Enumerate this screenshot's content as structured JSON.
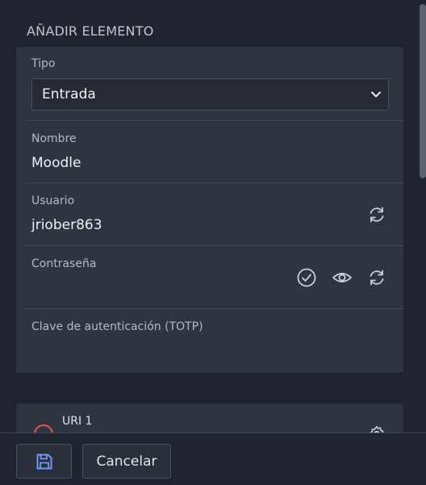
{
  "heading": "AÑADIR ELEMENTO",
  "form": {
    "tipo": {
      "label": "Tipo",
      "value": "Entrada"
    },
    "nombre": {
      "label": "Nombre",
      "value": "Moodle"
    },
    "usuario": {
      "label": "Usuario",
      "value": "jriober863"
    },
    "contrasena": {
      "label": "Contraseña",
      "value": ""
    },
    "totp": {
      "label": "Clave de autenticación (TOTP)",
      "value": ""
    }
  },
  "uri": {
    "label": "URI 1"
  },
  "footer": {
    "cancel_label": "Cancelar"
  },
  "colors": {
    "accent": "#6f9bff",
    "danger": "#e5555b",
    "background": "#1f242e",
    "card": "#2f3540"
  },
  "icons": [
    "chevron-down-icon",
    "refresh-icon",
    "check-circle-icon",
    "eye-icon",
    "save-icon",
    "remove-circle-icon",
    "gear-icon"
  ]
}
